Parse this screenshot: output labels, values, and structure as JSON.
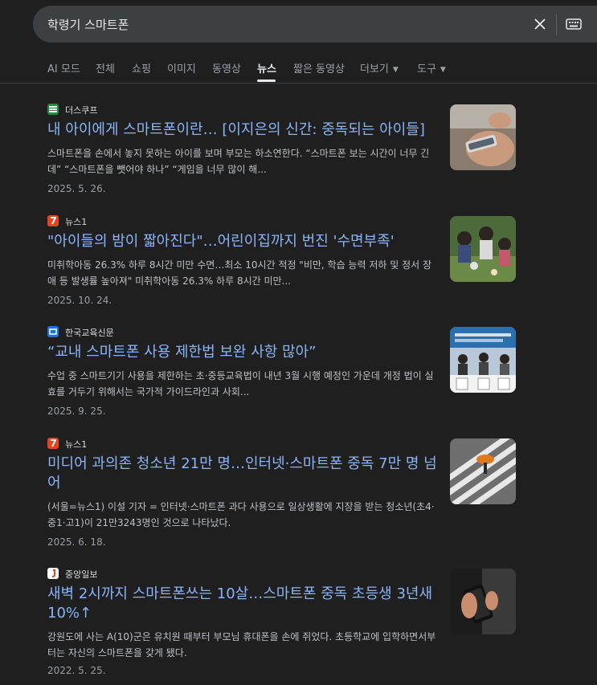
{
  "search": {
    "query": "학령기 스마트폰"
  },
  "tabs": [
    {
      "label": "AI 모드"
    },
    {
      "label": "전체"
    },
    {
      "label": "쇼핑"
    },
    {
      "label": "이미지"
    },
    {
      "label": "동영상"
    },
    {
      "label": "뉴스",
      "active": true
    },
    {
      "label": "짧은 동영상"
    },
    {
      "label": "더보기"
    },
    {
      "label": "도구"
    }
  ],
  "results": [
    {
      "source": "더스쿠프",
      "title": "내 아이에게 스마트폰이란… [이지은의 신간: 중독되는 아이들]",
      "snippet": "스마트폰을 손에서 놓지 못하는 아이를 보며 부모는 하소연한다. “스마트폰 보는 시간이 너무 긴데” “스마트폰을 뺏어야 하나” “게임을 너무 많이 해...",
      "date": "2025. 5. 26.",
      "favicon_color": "#1e8e3e",
      "thumb_icon": "phone-in-hand-photo"
    },
    {
      "source": "뉴스1",
      "title": "\"아이들의 밤이 짧아진다\"…어린이집까지 번진 '수면부족'",
      "snippet": "미취학아동 26.3% 하루 8시간 미만 수면…최소 10시간 적정 \"비만, 학습 능력 저하 및 정서 장애 등 발생률 높아져\" 미취학아동 26.3% 하루 8시간 미만...",
      "date": "2025. 10. 24.",
      "favicon_color": "#e8431f",
      "thumb_icon": "children-outdoors-photo"
    },
    {
      "source": "한국교육신문",
      "title": "“교내 스마트폰 사용 제한법 보완 사항 많아”",
      "snippet": "수업 중 스마트기기 사용을 제한하는 초·중등교육법이 내년 3월 시행 예정인 가운데 개정 법이 실효를 거두기 위해서는 국가적 가이드라인과 사회...",
      "date": "2025. 9. 25.",
      "favicon_color": "#1a73e8",
      "thumb_icon": "forum-panel-photo"
    },
    {
      "source": "뉴스1",
      "title": "미디어 과의존 청소년 21만 명…인터넷·스마트폰 중독 7만 명 넘어",
      "snippet": "(서울=뉴스1) 이설 기자 = 인터넷·스마트폰 과다 사용으로 일상생활에 지장을 받는 청소년(초4·중1·고1)이 21만3243명인 것으로 나타났다.",
      "date": "2025. 6. 18.",
      "favicon_color": "#e8431f",
      "thumb_icon": "crosswalk-umbrella-photo"
    },
    {
      "source": "중앙일보",
      "title": "새벽 2시까지 스마트폰쓰는 10살…스마트폰 중독 초등생 3년새 10%↑",
      "snippet": "강원도에 사는 A(10)군은 유치원 때부터 부모님 휴대폰을 손에 쥐었다. 초등학교에 입학하면서부터는 자신의 스마트폰을 갖게 됐다.",
      "date": "2022. 5. 25.",
      "favicon_color": "#ffffff",
      "thumb_icon": "phone-in-hands-photo"
    }
  ]
}
